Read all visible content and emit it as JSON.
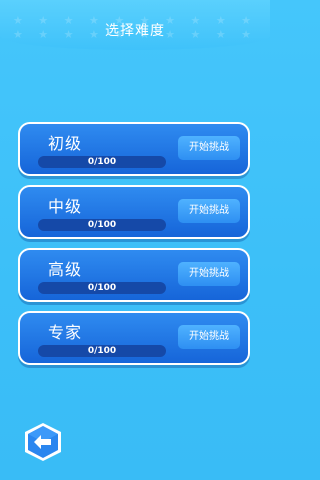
{
  "header": {
    "title": "选择难度",
    "background_color": "#4cc9fc"
  },
  "levels": [
    {
      "name": "初级",
      "progress_text": "0/100",
      "progress_fraction": 0,
      "button_label": "开始挑战"
    },
    {
      "name": "中级",
      "progress_text": "0/100",
      "progress_fraction": 0,
      "button_label": "开始挑战"
    },
    {
      "name": "高级",
      "progress_text": "0/100",
      "progress_fraction": 0,
      "button_label": "开始挑战"
    },
    {
      "name": "专家",
      "progress_text": "0/100",
      "progress_fraction": 0,
      "button_label": "开始挑战"
    }
  ],
  "back_button": {
    "icon": "left-arrow-icon"
  },
  "colors": {
    "card": "#1f73e3",
    "card_border": "#ffffff",
    "button": "#3a9cf7",
    "progress_track": "#1549a8"
  }
}
